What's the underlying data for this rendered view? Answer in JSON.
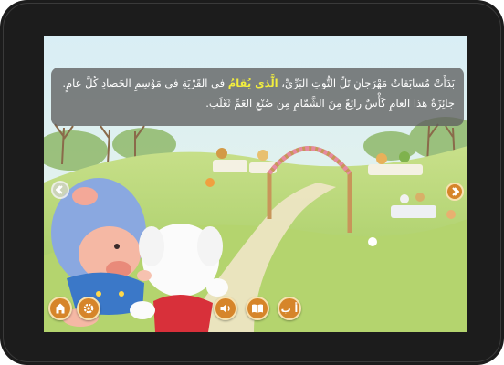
{
  "story": {
    "line1": {
      "part1": "بَدَأَتْ مُسابَقاتُ مَهْرَجانِ تَلِّ التُّوتِ البَرِّيِّ،",
      "highlight": "الَّذي يُقامُ",
      "part2": "في القَرْيَةِ في مَوْسِمِ الحَصادِ كُلَّ عامٍ."
    },
    "line2": "جائِزَةُ هذا العامِ كَأْسٌ رائِعٌ مِنَ الشَّمّامِ مِن صُنْعِ العَمِّ ثَعْلَب."
  },
  "controls": {
    "text_toggle_label": "أ ب"
  },
  "icons": {
    "home": "home-icon",
    "settings": "gear-icon",
    "audio": "speaker-icon",
    "library": "book-icon",
    "text": "text-icon",
    "prev": "chevron-left-icon",
    "next": "chevron-right-icon"
  },
  "colors": {
    "button": "#d6852a",
    "button_border": "#f7e2b0",
    "highlight_word": "#f2ee3e",
    "caption_bg": "#5f5f5f",
    "bezel": "#1c1c1c"
  }
}
